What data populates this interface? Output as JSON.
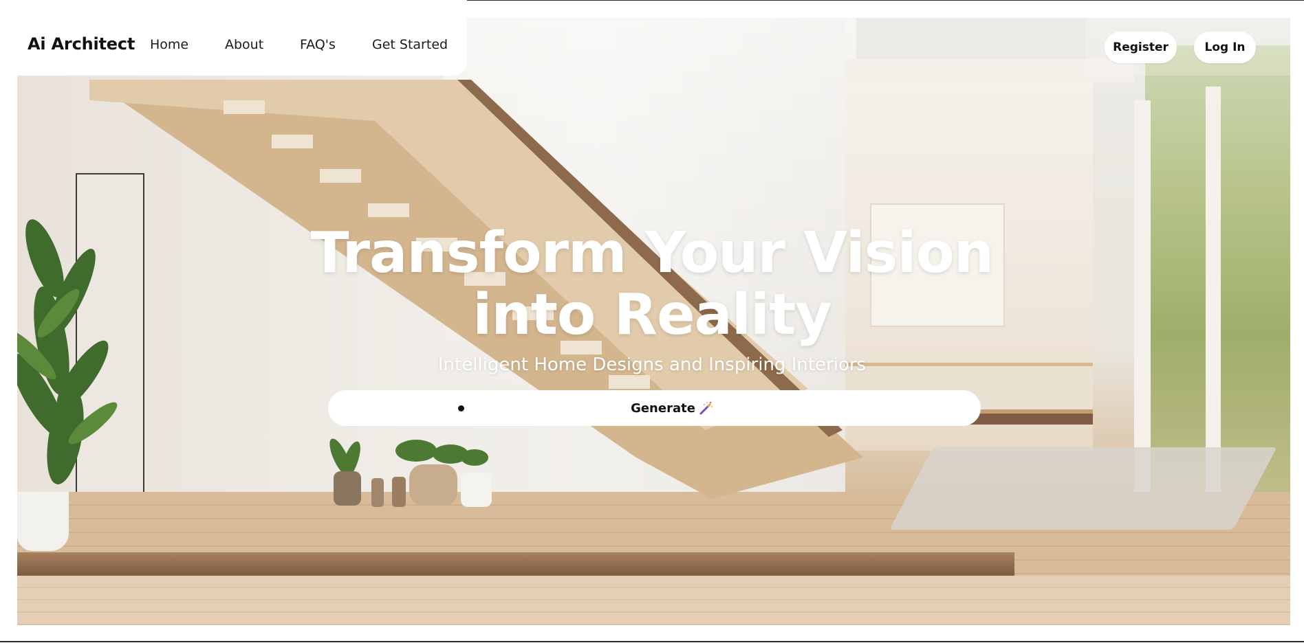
{
  "brand": {
    "name": "Ai Architect"
  },
  "nav": {
    "links": [
      {
        "label": "Home"
      },
      {
        "label": "About"
      },
      {
        "label": "FAQ's"
      },
      {
        "label": "Get Started"
      }
    ]
  },
  "auth": {
    "register_label": "Register",
    "login_label": "Log In"
  },
  "hero": {
    "title_line1": "Transform Your Vision",
    "title_line2": "into Reality",
    "subtitle": "Intelligent Home Designs and Inspiring Interiors"
  },
  "prompt": {
    "value": "",
    "placeholder": "",
    "generate_label": "Generate",
    "generate_icon": "magic-wand-icon"
  },
  "colors": {
    "nav_background": "#ffffff",
    "button_background": "#ffffff",
    "text_dark": "#111111",
    "hero_text": "#ffffff"
  }
}
